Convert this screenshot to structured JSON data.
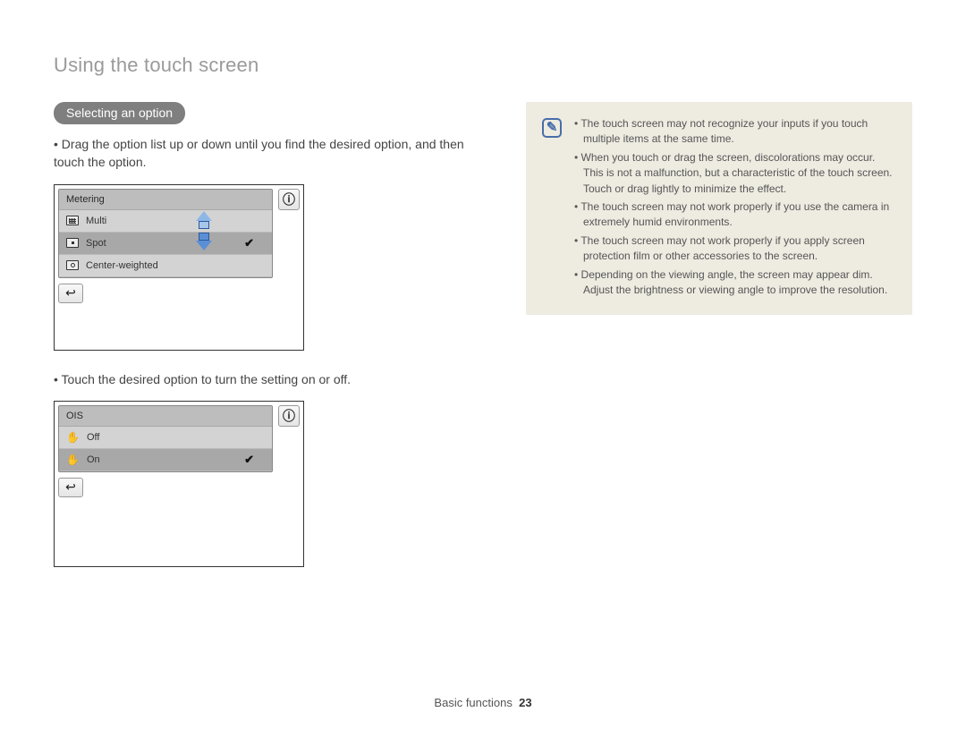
{
  "header": "Using the touch screen",
  "section_title": "Selecting an option",
  "instructions": {
    "drag": "Drag the option list up or down until you find the desired option, and then touch the option.",
    "touch": "Touch the desired option to turn the setting on or off."
  },
  "panel1": {
    "title": "Metering",
    "options": [
      {
        "label": "Multi"
      },
      {
        "label": "Spot"
      },
      {
        "label": "Center-weighted"
      }
    ]
  },
  "panel2": {
    "title": "OIS",
    "options": [
      {
        "label": "Off"
      },
      {
        "label": "On"
      }
    ]
  },
  "notes": [
    "The touch screen may not recognize your inputs if you touch multiple items at the same time.",
    "When you touch or drag the screen, discolorations may occur. This is not a malfunction, but a characteristic of the touch screen. Touch or drag lightly to minimize the effect.",
    "The touch screen may not work properly if you use the camera in extremely humid environments.",
    "The touch screen may not work properly if you apply screen protection film or other accessories to the screen.",
    "Depending on the viewing angle, the screen may appear dim. Adjust the brightness or viewing angle to improve the resolution."
  ],
  "footer": {
    "section": "Basic functions",
    "page": "23"
  }
}
